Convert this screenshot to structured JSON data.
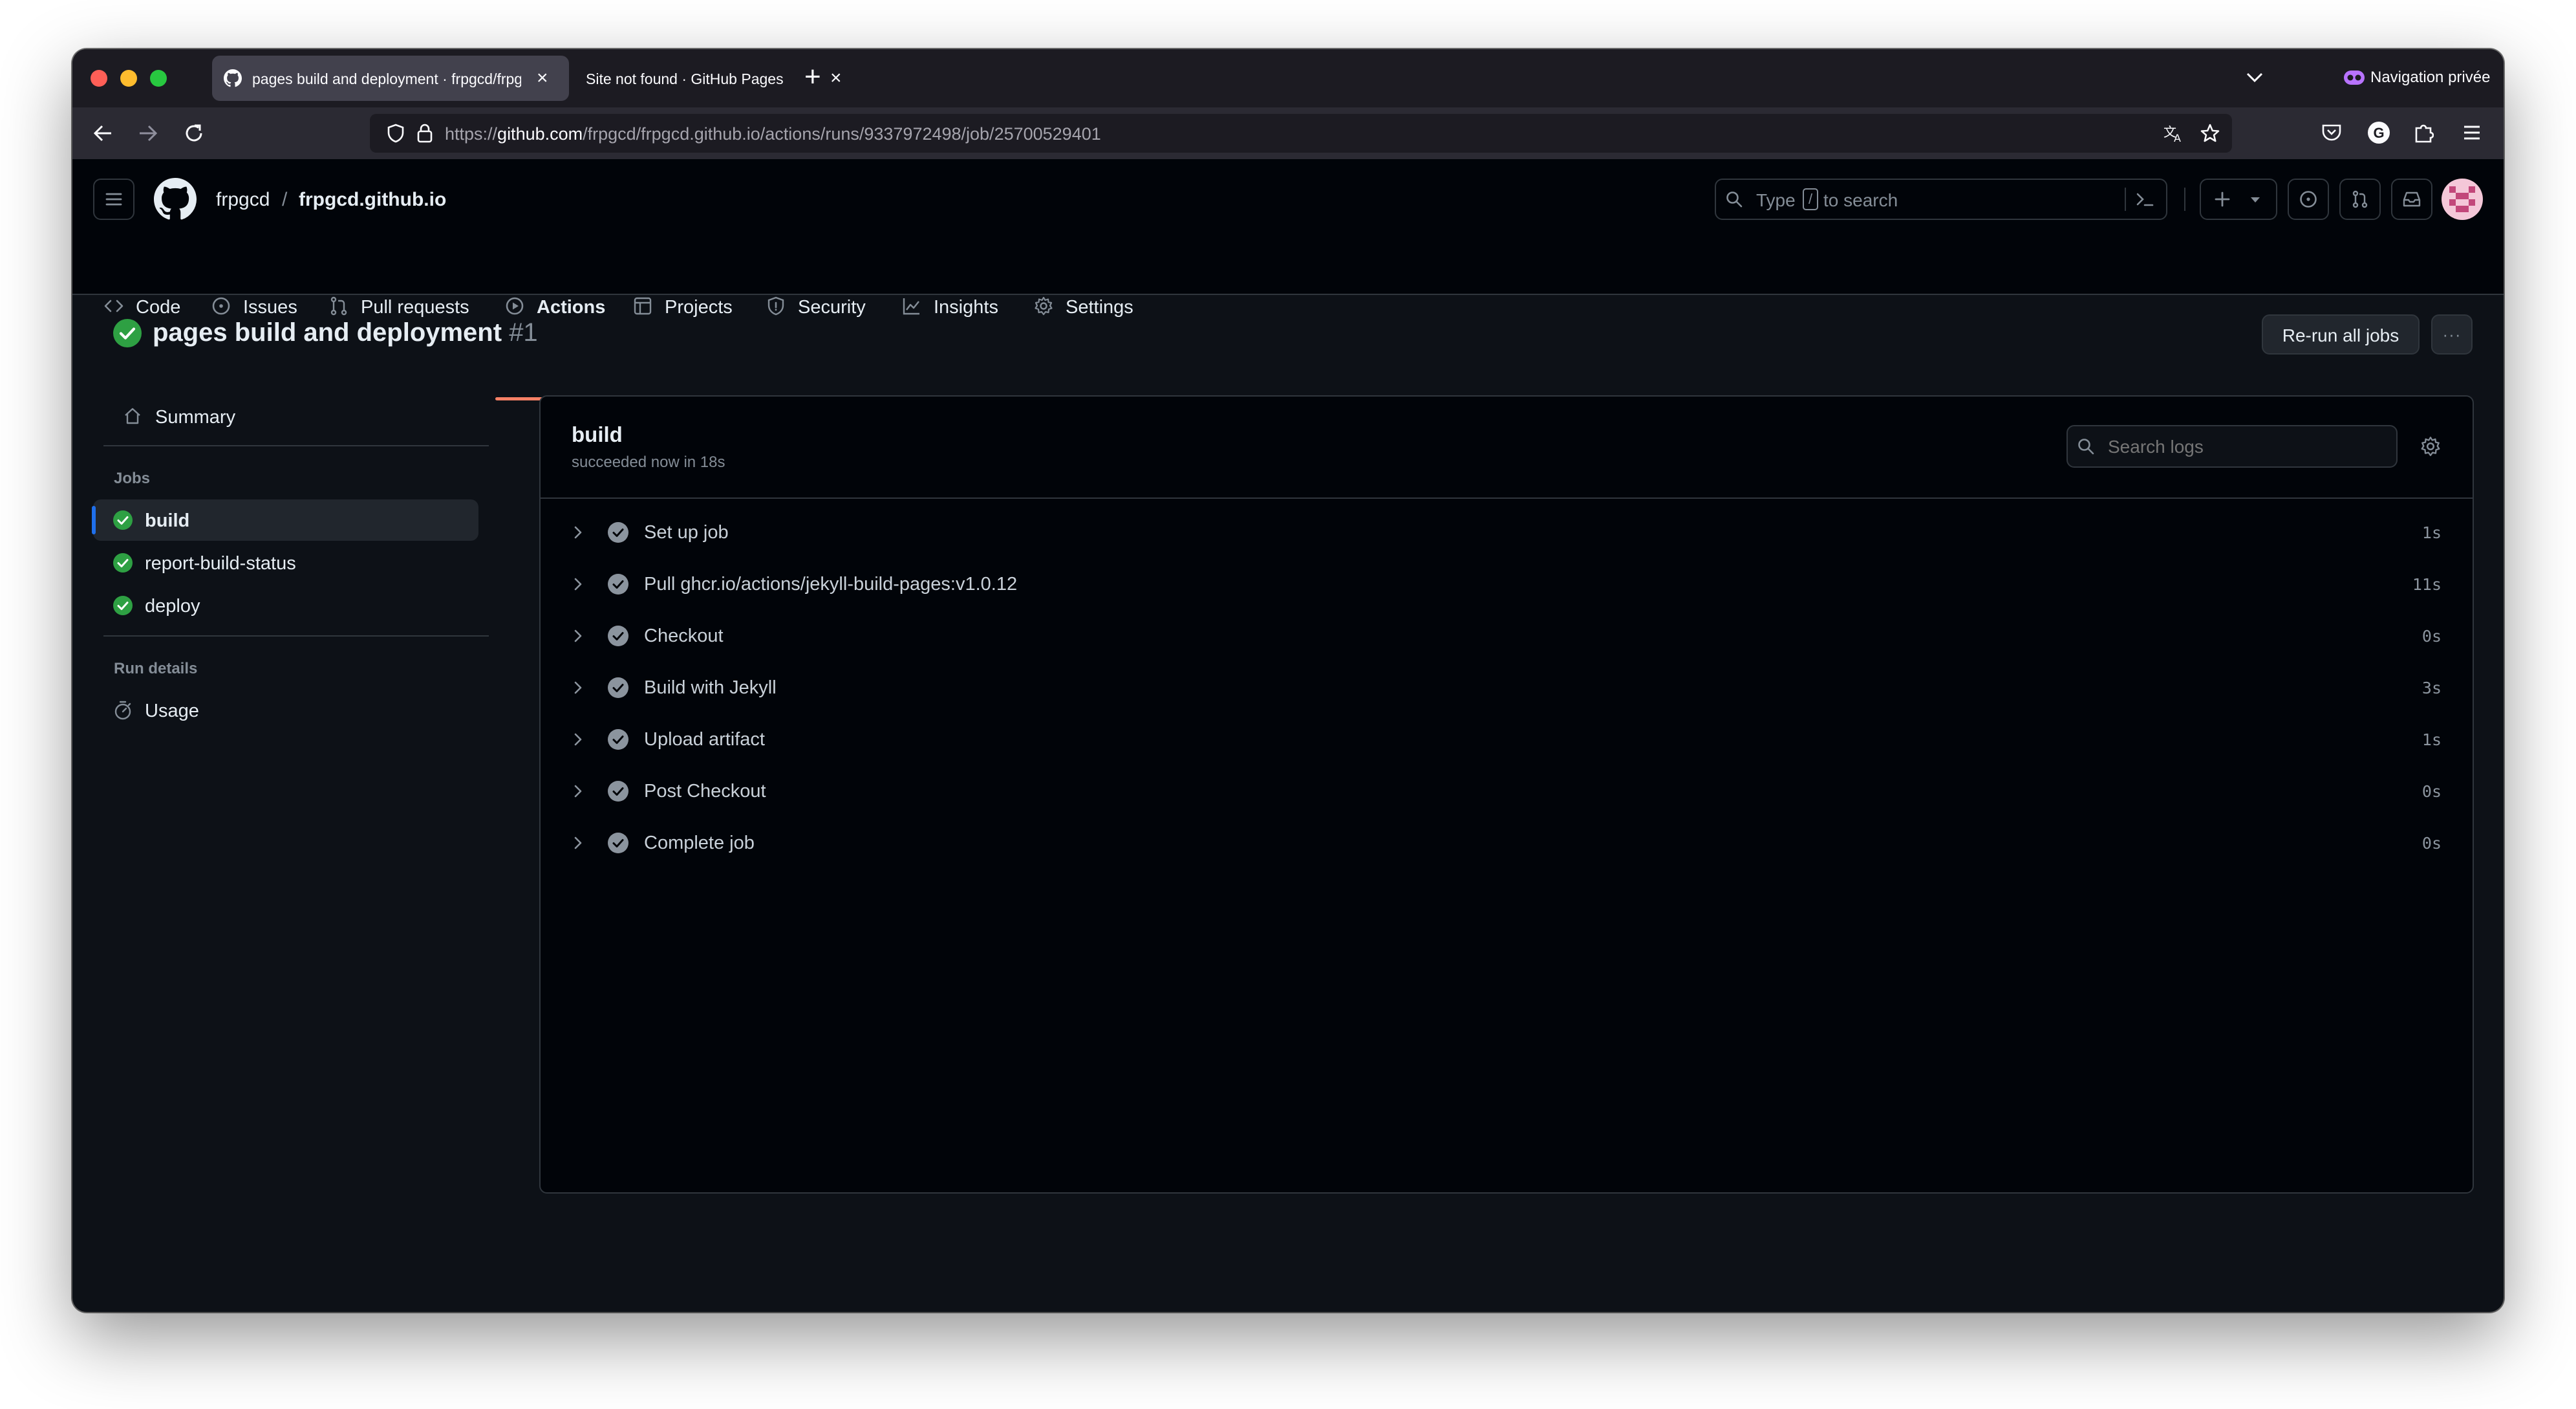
{
  "browser": {
    "tabs": [
      {
        "title": "pages build and deployment · frpgcd/frpgcd.github.io",
        "active": true
      },
      {
        "title": "Site not found · GitHub Pages",
        "active": false
      }
    ],
    "url": {
      "origin": "https://",
      "host": "github.com",
      "path": "/frpgcd/frpgcd.github.io/actions/runs/9337972498/job/25700529401"
    },
    "private_label": "Navigation privée",
    "account_letter": "G",
    "new_tab_glyph": "+",
    "close_glyph": "×"
  },
  "header": {
    "owner": "frpgcd",
    "separator": "/",
    "repo": "frpgcd.github.io",
    "search_type": "Type",
    "search_key": "/",
    "search_rest": "to search"
  },
  "repo_nav": {
    "items": [
      {
        "label": "Code",
        "icon": "code-icon"
      },
      {
        "label": "Issues",
        "icon": "issue-icon"
      },
      {
        "label": "Pull requests",
        "icon": "pull-request-icon"
      },
      {
        "label": "Actions",
        "icon": "play-icon",
        "selected": true
      },
      {
        "label": "Projects",
        "icon": "table-icon"
      },
      {
        "label": "Security",
        "icon": "shield-icon"
      },
      {
        "label": "Insights",
        "icon": "graph-icon"
      },
      {
        "label": "Settings",
        "icon": "gear-icon"
      }
    ]
  },
  "run": {
    "title": "pages build and deployment",
    "number": "#1",
    "rerun_label": "Re-run all jobs",
    "more_glyph": "···"
  },
  "sidebar": {
    "summary": "Summary",
    "jobs_heading": "Jobs",
    "jobs": [
      {
        "label": "build",
        "selected": true
      },
      {
        "label": "report-build-status",
        "selected": false
      },
      {
        "label": "deploy",
        "selected": false
      }
    ],
    "details_heading": "Run details",
    "usage": "Usage"
  },
  "job": {
    "name": "build",
    "status": "succeeded now in 18s",
    "search_placeholder": "Search logs",
    "steps": [
      {
        "name": "Set up job",
        "duration": "1s"
      },
      {
        "name": "Pull ghcr.io/actions/jekyll-build-pages:v1.0.12",
        "duration": "11s"
      },
      {
        "name": "Checkout",
        "duration": "0s"
      },
      {
        "name": "Build with Jekyll",
        "duration": "3s"
      },
      {
        "name": "Upload artifact",
        "duration": "1s"
      },
      {
        "name": "Post Checkout",
        "duration": "0s"
      },
      {
        "name": "Complete job",
        "duration": "0s"
      }
    ]
  },
  "colors": {
    "success": "#2ea043",
    "accent_underline": "#f78166",
    "selected_bar": "#1f6feb",
    "bg": "#0d1117"
  }
}
